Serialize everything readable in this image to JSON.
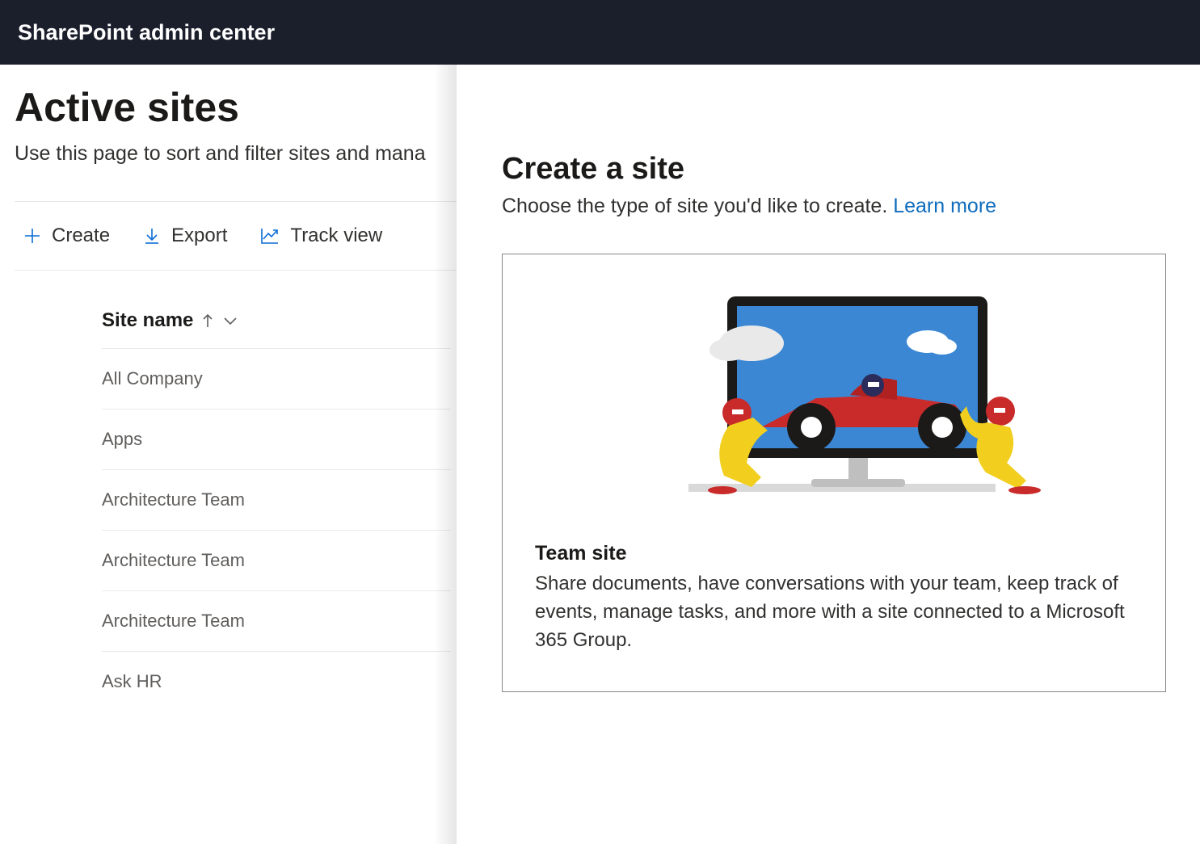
{
  "header": {
    "title": "SharePoint admin center"
  },
  "main": {
    "title": "Active sites",
    "description": "Use this page to sort and filter sites and mana",
    "toolbar": {
      "create": "Create",
      "export": "Export",
      "trackview": "Track view"
    },
    "table": {
      "column_header": "Site name",
      "rows": [
        "All Company",
        "Apps",
        "Architecture Team",
        "Architecture Team",
        "Architecture Team",
        "Ask HR"
      ]
    }
  },
  "panel": {
    "title": "Create a site",
    "description": "Choose the type of site you'd like to create. ",
    "learn_more": "Learn more",
    "card": {
      "title": "Team site",
      "description": "Share documents, have conversations with your team, keep track of events, manage tasks, and more with a site connected to a Microsoft 365 Group."
    }
  }
}
